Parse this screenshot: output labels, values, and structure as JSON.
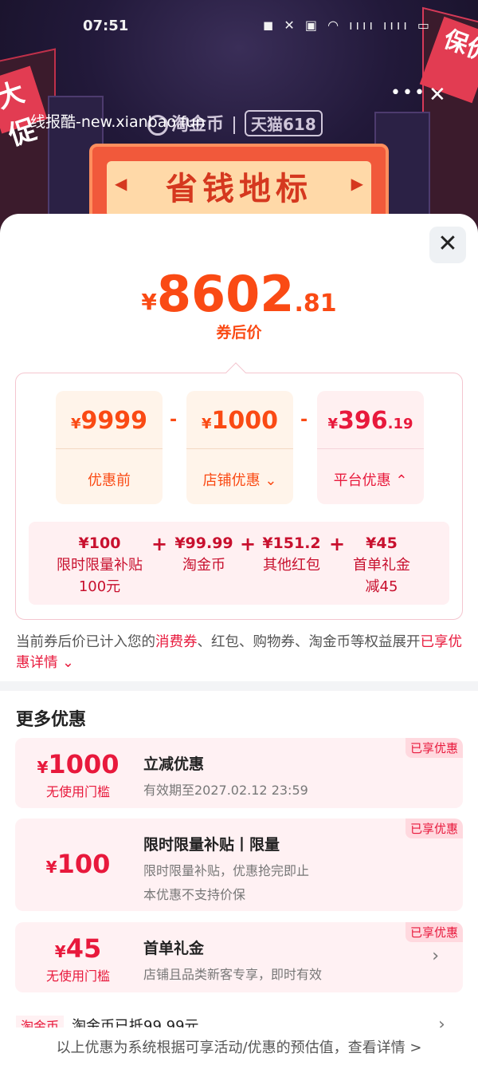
{
  "status_bar": {
    "time": "07:51",
    "icons": "◼ ✕ ▣ ◠ ıııı ıııı ▭"
  },
  "banner": {
    "watermark": "线报酷-new.xianbao.fun",
    "brand": "淘金币",
    "partner": "天猫618",
    "landmark": "省钱地标",
    "neon_left": "大促",
    "neon_right": "保价"
  },
  "summary": {
    "currency": "¥",
    "final_int": "8602",
    "final_dec": ".81",
    "final_label": "券后价"
  },
  "calc": {
    "before": {
      "currency": "¥",
      "value": "9999",
      "label": "优惠前"
    },
    "shop": {
      "currency": "¥",
      "value": "1000",
      "label": "店铺优惠"
    },
    "platform": {
      "currency": "¥",
      "value_int": "396",
      "value_dec": ".19",
      "label": "平台优惠"
    },
    "minus": "-",
    "plus": "+",
    "breakdown": [
      {
        "value": "¥100",
        "line1": "限时限量补贴",
        "line2": "100元"
      },
      {
        "value": "¥99.99",
        "line1": "淘金币",
        "line2": ""
      },
      {
        "value": "¥151.2",
        "line1": "其他红包",
        "line2": ""
      },
      {
        "value": "¥45",
        "line1": "首单礼金",
        "line2": "减45"
      }
    ]
  },
  "note": {
    "prefix": "当前券后价已计入您的",
    "highlight": "消费券",
    "middle": "、红包、购物券、淘金币等权益展开",
    "link": "已享优惠详情"
  },
  "more": {
    "title": "更多优惠",
    "cards": [
      {
        "currency": "¥",
        "value": "1000",
        "cond": "无使用门槛",
        "title": "立减优惠",
        "desc1": "有效期至2027.02.12 23:59",
        "desc2": "",
        "tag": "已享优惠"
      },
      {
        "currency": "¥",
        "value": "100",
        "cond": "",
        "title": "限时限量补贴丨限量",
        "desc1": "限时限量补贴，优惠抢完即止",
        "desc2": "本优惠不支持价保",
        "tag": "已享优惠"
      },
      {
        "currency": "¥",
        "value": "45",
        "cond": "无使用门槛",
        "title": "首单礼金",
        "desc1": "店铺且品类新客专享，即时有效",
        "desc2": "",
        "tag": "已享优惠"
      }
    ],
    "peek_tag": "淘金币",
    "peek_text": "淘金币已抵99.99元"
  },
  "footer": "以上优惠为系统根据可享活动/优惠的预估值，查看详情 >"
}
